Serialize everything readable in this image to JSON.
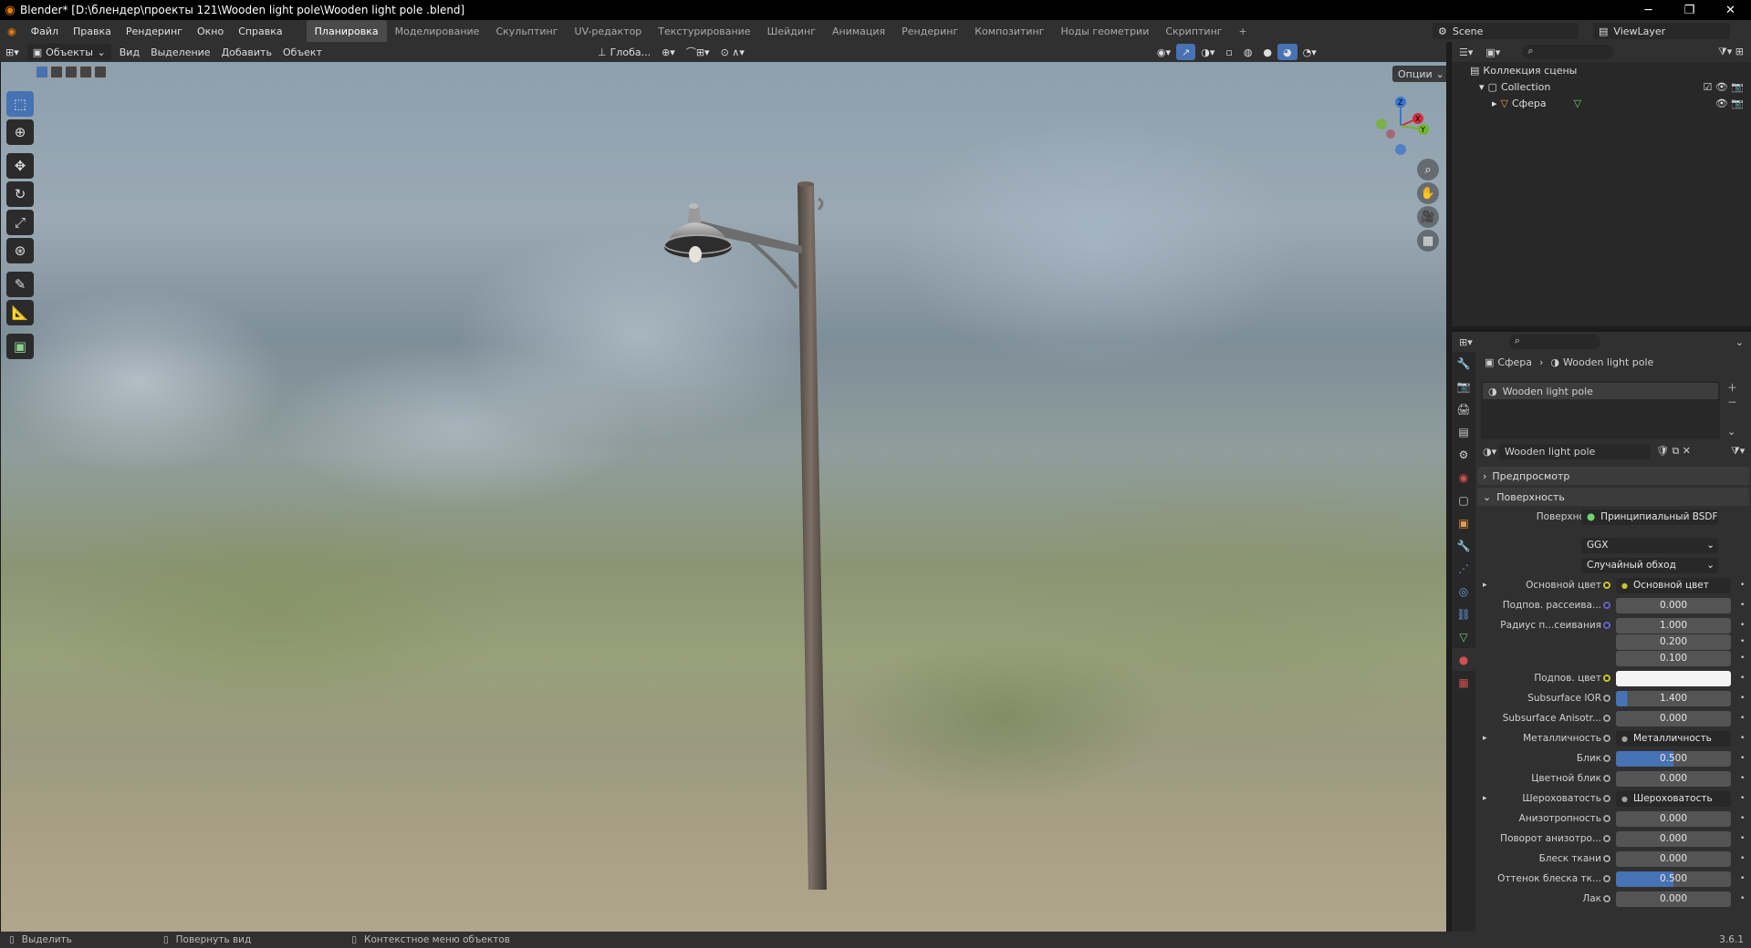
{
  "window": {
    "title": "Blender* [D:\\блендер\\проекты 121\\Wooden light pole\\Wooden light pole .blend]",
    "minimize": "─",
    "maximize": "❐",
    "close": "✕"
  },
  "menu": [
    "Файл",
    "Правка",
    "Рендеринг",
    "Окно",
    "Справка"
  ],
  "workspaces": [
    "Планировка",
    "Моделирование",
    "Скульптинг",
    "UV-редактор",
    "Текстурирование",
    "Шейдинг",
    "Анимация",
    "Рендеринг",
    "Композитинг",
    "Ноды геометрии",
    "Скриптинг",
    "+"
  ],
  "scene": "Scene",
  "view_layer": "ViewLayer",
  "viewport_header": {
    "mode": "Объекты",
    "items": [
      "Вид",
      "Выделение",
      "Добавить",
      "Объект"
    ],
    "orientation": "Глоба...",
    "options": "Опции"
  },
  "gizmo": {
    "z": "Z",
    "y": "Y",
    "x": "X"
  },
  "outliner": {
    "root": "Коллекция сцены",
    "collection": "Collection",
    "object": "Сфера"
  },
  "properties": {
    "breadcrumb": {
      "object": "Сфера",
      "material": "Wooden light pole"
    },
    "slot": "Wooden light pole",
    "material_name": "Wooden light pole",
    "sections": {
      "preview": "Предпросмотр",
      "surface": "Поверхность"
    },
    "surface_label": "Поверхность",
    "surface_value": "Принципиальный BSDF",
    "distribution": "GGX",
    "subsurface_method": "Случайный обход",
    "rows": [
      {
        "label": "Основной цвет",
        "value": "Основной цвет",
        "type": "socket",
        "dot": "#c7c729"
      },
      {
        "label": "Подпов. рассеива...",
        "value": "0.000",
        "type": "num",
        "dot": "#6363c7"
      },
      {
        "label": "Радиус п...сеивания",
        "value": "1.000",
        "type": "num",
        "dot": "#6363c7"
      },
      {
        "label": "",
        "value": "0.200",
        "type": "num"
      },
      {
        "label": "",
        "value": "0.100",
        "type": "num"
      },
      {
        "label": "Подпов. цвет",
        "value": "",
        "type": "color",
        "dot": "#c7c729"
      },
      {
        "label": "Subsurface IOR",
        "value": "1.400",
        "type": "ior",
        "dot": "#a1a1a1"
      },
      {
        "label": "Subsurface Anisotr...",
        "value": "0.000",
        "type": "num",
        "dot": "#a1a1a1"
      },
      {
        "label": "Металличность",
        "value": "Металличность",
        "type": "socket",
        "dot": "#a1a1a1"
      },
      {
        "label": "Блик",
        "value": "0.500",
        "type": "blue",
        "dot": "#a1a1a1"
      },
      {
        "label": "Цветной блик",
        "value": "0.000",
        "type": "num",
        "dot": "#a1a1a1"
      },
      {
        "label": "Шероховатость",
        "value": "Шероховатость",
        "type": "socket",
        "dot": "#a1a1a1"
      },
      {
        "label": "Анизотропность",
        "value": "0.000",
        "type": "num",
        "dot": "#a1a1a1"
      },
      {
        "label": "Поворот анизотро...",
        "value": "0.000",
        "type": "num",
        "dot": "#a1a1a1"
      },
      {
        "label": "Блеск ткани",
        "value": "0.000",
        "type": "num",
        "dot": "#a1a1a1"
      },
      {
        "label": "Оттенок блеска тк...",
        "value": "0.500",
        "type": "blue",
        "dot": "#a1a1a1"
      },
      {
        "label": "Лак",
        "value": "0.000",
        "type": "num",
        "dot": "#a1a1a1"
      }
    ]
  },
  "status": {
    "select": "Выделить",
    "rotate": "Повернуть вид",
    "context": "Контекстное меню объектов",
    "version": "3.6.1"
  },
  "ior_fill_percent": 10
}
